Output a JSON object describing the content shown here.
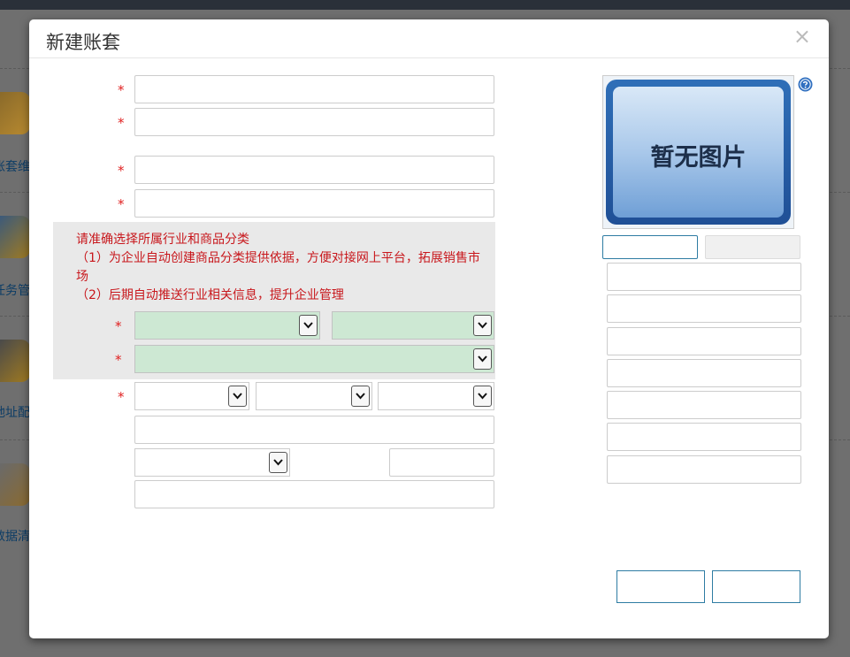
{
  "dialog": {
    "title": "新建账套",
    "close_label": "×"
  },
  "background_menu": [
    {
      "label": "账套维",
      "icon": "wrench-icon"
    },
    {
      "label": "任务管",
      "icon": "monitor-user-icon"
    },
    {
      "label": "地址配",
      "icon": "server-gear-icon"
    },
    {
      "label": "数据清",
      "icon": "document-icon"
    }
  ],
  "form": {
    "required_mark": "*",
    "notice_lines": [
      "请准确选择所属行业和商品分类",
      "（1）为企业自动创建商品分类提供依据，方便对接网上平台，拓展销售市场",
      "（2）后期自动推送行业相关信息，提升企业管理"
    ]
  },
  "photo": {
    "placeholder_text": "暂无图片"
  },
  "colors": {
    "required": "#e02020",
    "notice_text": "#c8171c",
    "notice_bg": "#e9e9e9",
    "industry_select_bg": "#cde8d3",
    "button_border": "#2e7ca3"
  }
}
